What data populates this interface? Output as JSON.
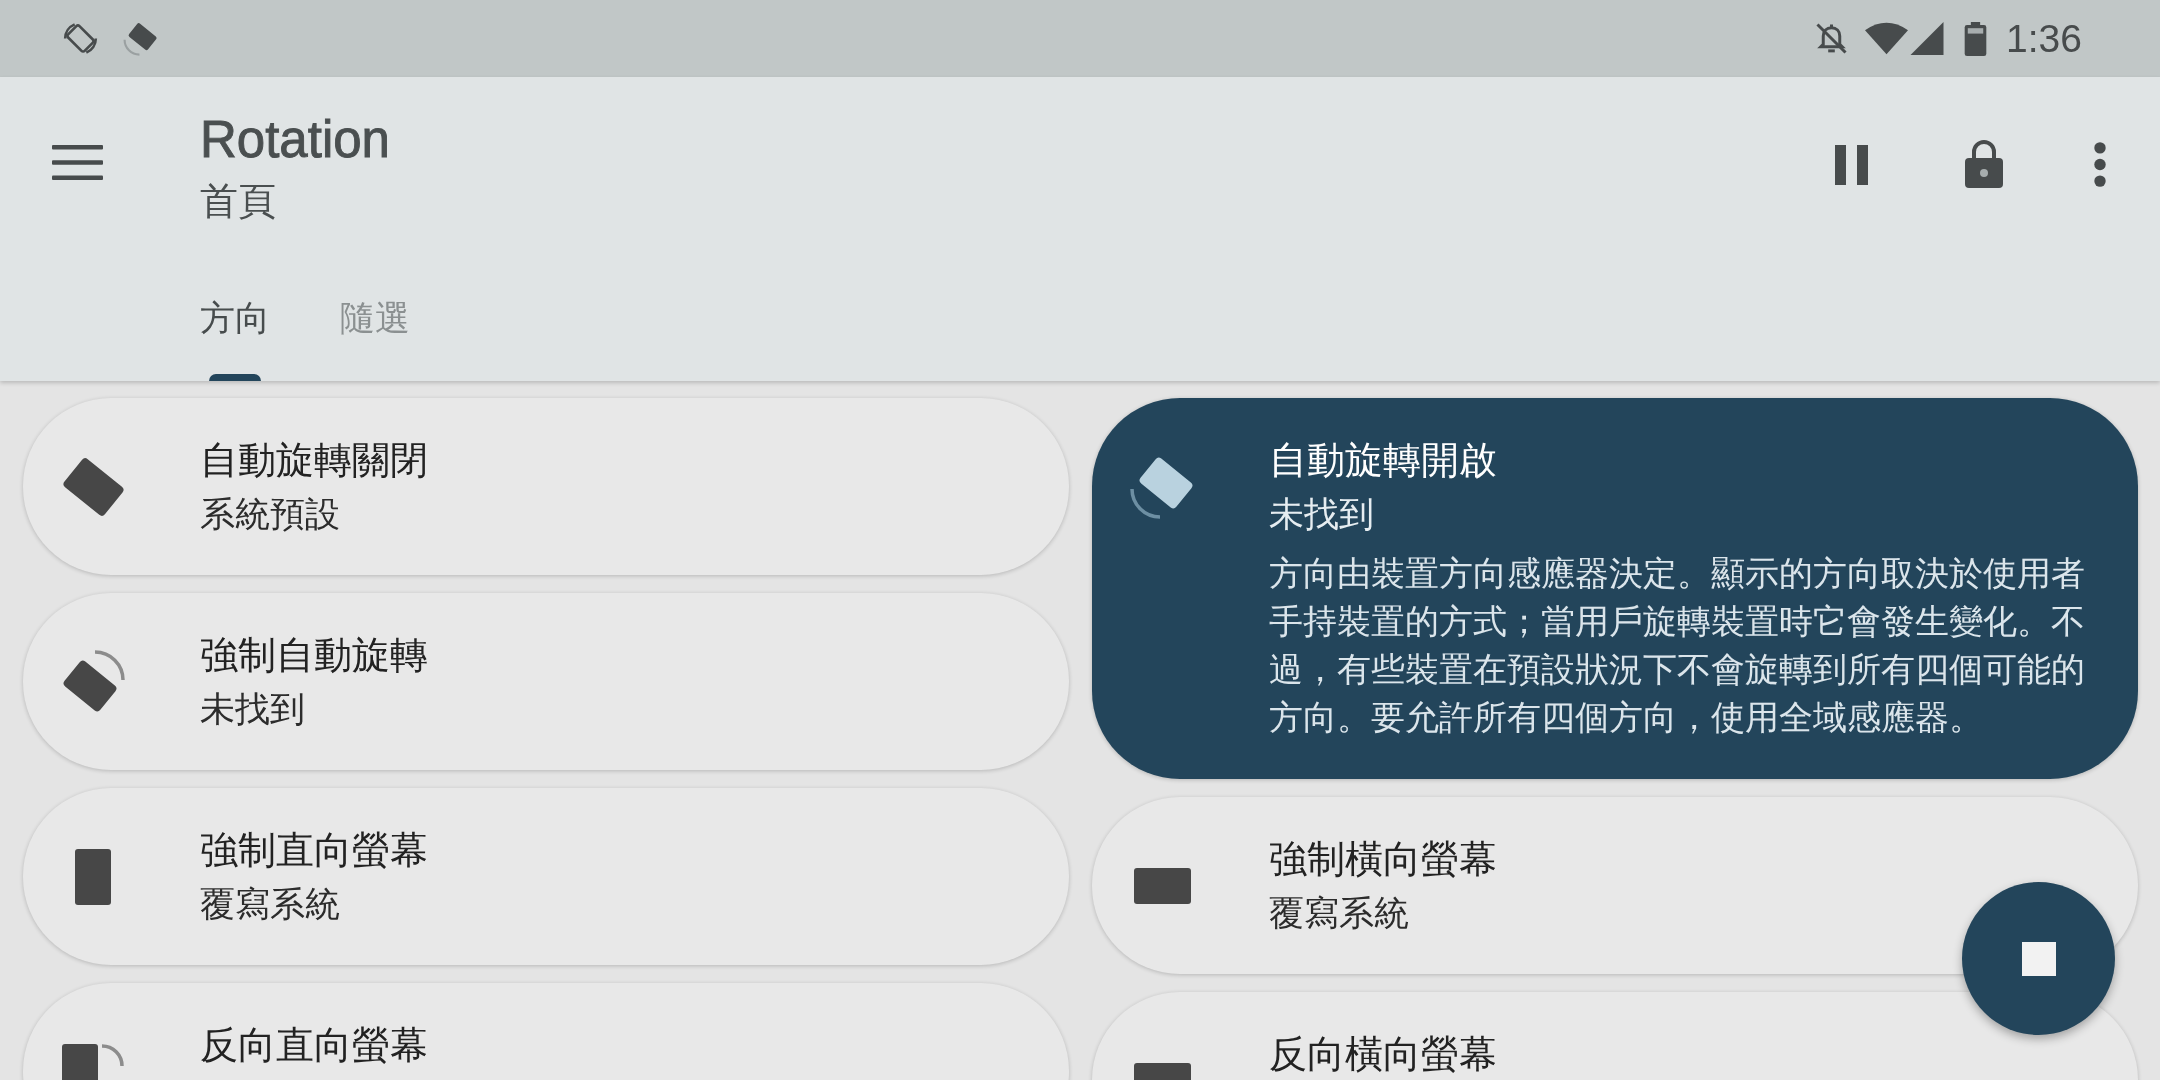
{
  "status_bar": {
    "time": "1:36"
  },
  "app_bar": {
    "title": "Rotation",
    "subtitle": "首頁"
  },
  "tabs": [
    {
      "label": "方向",
      "selected": true
    },
    {
      "label": "隨選",
      "selected": false
    }
  ],
  "columns": [
    {
      "cards": [
        {
          "kind": "locked",
          "title": "自動旋轉關閉",
          "subtitle": "系統預設",
          "selected": false
        },
        {
          "kind": "forced",
          "title": "強制自動旋轉",
          "subtitle": "未找到",
          "selected": false
        },
        {
          "kind": "portrait",
          "title": "強制直向螢幕",
          "subtitle": "覆寫系統",
          "selected": false
        },
        {
          "kind": "reverseportrait",
          "title": "反向直向螢幕",
          "selected": false
        }
      ]
    },
    {
      "cards": [
        {
          "kind": "sensor",
          "title": "自動旋轉開啟",
          "subtitle": "未找到",
          "description": "方向由裝置方向感應器決定。顯示的方向取決於使用者手持裝置的方式；當用戶旋轉裝置時它會發生變化。不過，有些裝置在預設狀況下不會旋轉到所有四個可能的方向。要允許所有四個方向，使用全域感應器。",
          "selected": true
        },
        {
          "kind": "landscape",
          "title": "強制橫向螢幕",
          "subtitle": "覆寫系統",
          "selected": false
        },
        {
          "kind": "reverselandscape",
          "title": "反向橫向螢幕",
          "selected": false
        }
      ]
    }
  ]
}
